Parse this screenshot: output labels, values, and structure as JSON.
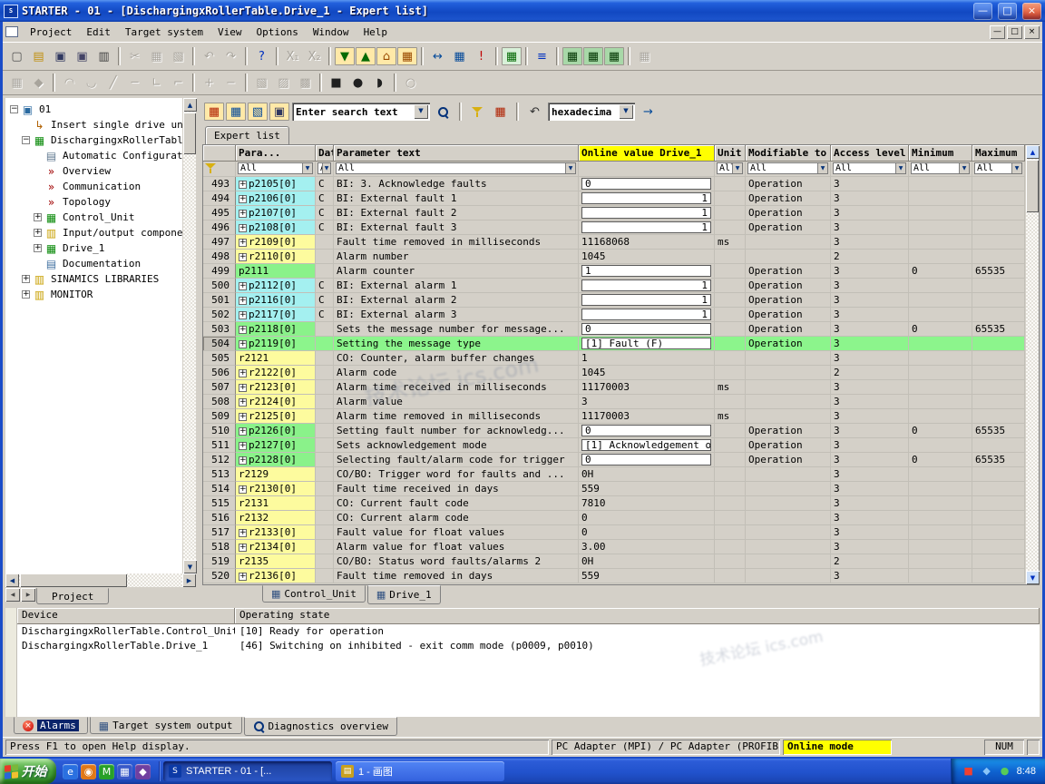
{
  "window": {
    "logo": "S",
    "title": "STARTER - 01 - [DischargingxRollerTable.Drive_1 - Expert list]",
    "controls": [
      "—",
      "□",
      "×"
    ],
    "menu": [
      "Project",
      "Edit",
      "Target system",
      "View",
      "Options",
      "Window",
      "Help"
    ]
  },
  "ui": {
    "up": "▲",
    "down": "▼",
    "left": "◀",
    "right": "▶",
    "combo": "▼"
  },
  "toolbars": {
    "row1": [
      {
        "name": "new-project",
        "glyph": "▢",
        "color": "#505050"
      },
      {
        "name": "open-project",
        "glyph": "▤",
        "color": "#c09010"
      },
      {
        "name": "save-project",
        "glyph": "▣",
        "color": "#303860"
      },
      {
        "name": "archive-project",
        "glyph": "▣",
        "color": "#446"
      },
      {
        "name": "print",
        "glyph": "▥",
        "color": "#404040"
      },
      {
        "sep": 1
      },
      {
        "name": "cut",
        "glyph": "✂",
        "dis": 1
      },
      {
        "name": "copy",
        "glyph": "▦",
        "dis": 1
      },
      {
        "name": "paste",
        "glyph": "▧",
        "dis": 1
      },
      {
        "sep": 1
      },
      {
        "name": "undo",
        "glyph": "↶",
        "dis": 1
      },
      {
        "name": "redo",
        "glyph": "↷",
        "dis": 1
      },
      {
        "sep": 1
      },
      {
        "name": "help",
        "glyph": "?",
        "color": "#0030c0"
      },
      {
        "sep": 1
      },
      {
        "name": "reference-x1",
        "glyph": "X₁",
        "dis": 1
      },
      {
        "name": "reference-x2",
        "glyph": "X₂",
        "dis": 1
      },
      {
        "sep": 1
      },
      {
        "name": "download-to-target",
        "glyph": "▼",
        "color": "#046a04",
        "bg": "#ffe9a8"
      },
      {
        "name": "upload-to-pg",
        "glyph": "▲",
        "color": "#046a04",
        "bg": "#ffe9a8"
      },
      {
        "name": "copy-ram-to-rom",
        "glyph": "⌂",
        "color": "#9a4a00",
        "bg": "#ffe9a8"
      },
      {
        "name": "load-to-file-system",
        "glyph": "▦",
        "color": "#9a4a00",
        "bg": "#ffe9a8"
      },
      {
        "sep": 1
      },
      {
        "name": "connect-drive",
        "glyph": "↔",
        "color": "#054a9a"
      },
      {
        "name": "compare-online-offline",
        "glyph": "▦",
        "color": "#054a9a"
      },
      {
        "name": "alarm-history",
        "glyph": "!",
        "color": "#c00000"
      },
      {
        "sep": 1
      },
      {
        "name": "accessible-nodes",
        "glyph": "▦",
        "color": "#056a05",
        "bg": "#d8f0d8"
      },
      {
        "sep": 1
      },
      {
        "name": "sort",
        "glyph": "≡",
        "color": "#0030c0"
      },
      {
        "sep": 1
      },
      {
        "name": "connect-to-target",
        "glyph": "▦",
        "color": "#053805",
        "bg": "#a8d8a8"
      },
      {
        "name": "disconnect-from-target",
        "glyph": "▦",
        "color": "#053805",
        "bg": "#a8d8a8"
      },
      {
        "name": "online-monitor",
        "glyph": "▦",
        "color": "#053805",
        "bg": "#a8d8a8"
      },
      {
        "sep": 1
      },
      {
        "name": "diagnostics",
        "glyph": "▦",
        "dis": 1
      }
    ],
    "row2": [
      {
        "name": "trace-grid",
        "glyph": "▦",
        "dis": 1
      },
      {
        "name": "function-generator",
        "glyph": "◆",
        "dis": 1
      },
      {
        "sep": 1
      },
      {
        "name": "curve-upper",
        "glyph": "◠",
        "dis": 1
      },
      {
        "name": "curve-lower",
        "glyph": "◡",
        "dis": 1
      },
      {
        "name": "line-diagonal",
        "glyph": "╱",
        "dis": 1
      },
      {
        "name": "line-horizontal",
        "glyph": "─",
        "dis": 1
      },
      {
        "name": "angle-tool",
        "glyph": "∟",
        "dis": 1
      },
      {
        "name": "step-tool",
        "glyph": "⌐",
        "dis": 1
      },
      {
        "sep": 1
      },
      {
        "name": "zoom-in",
        "glyph": "+",
        "dis": 1
      },
      {
        "name": "zoom-out",
        "glyph": "−",
        "dis": 1
      },
      {
        "sep": 1
      },
      {
        "name": "measure-grid-1",
        "glyph": "▧",
        "dis": 1
      },
      {
        "name": "measure-grid-2",
        "glyph": "▨",
        "dis": 1
      },
      {
        "name": "measure-grid-3",
        "glyph": "▩",
        "dis": 1
      },
      {
        "sep": 1
      },
      {
        "name": "shape-square",
        "glyph": "■",
        "color": "#202020"
      },
      {
        "name": "shape-circle",
        "glyph": "●",
        "color": "#202020"
      },
      {
        "name": "shape-half-circle",
        "glyph": "◗",
        "color": "#202020"
      },
      {
        "sep": 1
      },
      {
        "name": "marker",
        "glyph": "○",
        "dis": 1
      }
    ]
  },
  "tree": {
    "tab": "Project",
    "items": [
      {
        "label": "01",
        "level": 0,
        "expand": "minus",
        "icon": "project-node",
        "glyph": "▣",
        "color": "#2a6aa0"
      },
      {
        "label": "Insert single drive unit",
        "level": 1,
        "icon": "insert-drive-unit",
        "glyph": "↳",
        "color": "#b06000"
      },
      {
        "label": "DischargingxRollerTabl",
        "level": 1,
        "expand": "minus",
        "icon": "drive-unit",
        "glyph": "▦",
        "color": "#0a8a0a"
      },
      {
        "label": "Automatic Configuratio",
        "level": 2,
        "icon": "automatic-configuration",
        "glyph": "▤",
        "color": "#607890"
      },
      {
        "label": "Overview",
        "level": 2,
        "icon": "overview",
        "glyph": "»",
        "color": "#a00000"
      },
      {
        "label": "Communication",
        "level": 2,
        "icon": "communication",
        "glyph": "»",
        "color": "#a00000"
      },
      {
        "label": "Topology",
        "level": 2,
        "icon": "topology",
        "glyph": "»",
        "color": "#a00000"
      },
      {
        "label": "Control_Unit",
        "level": 2,
        "expand": "plus",
        "icon": "control-unit",
        "glyph": "▦",
        "color": "#0a8a0a"
      },
      {
        "label": "Input/output component",
        "level": 2,
        "expand": "plus",
        "icon": "io-components-folder",
        "glyph": "▥",
        "color": "#c8a000"
      },
      {
        "label": "Drive_1",
        "level": 2,
        "expand": "plus",
        "icon": "drive",
        "glyph": "▦",
        "color": "#0a8a0a"
      },
      {
        "label": "Documentation",
        "level": 2,
        "icon": "documentation",
        "glyph": "▤",
        "color": "#4070a0"
      },
      {
        "label": "SINAMICS LIBRARIES",
        "level": 1,
        "expand": "plus",
        "icon": "libraries-folder",
        "glyph": "▥",
        "color": "#c8a000"
      },
      {
        "label": "MONITOR",
        "level": 1,
        "expand": "plus",
        "icon": "monitor-folder",
        "glyph": "▥",
        "color": "#c8a000"
      }
    ]
  },
  "expert": {
    "tab": "Expert list",
    "search_text": "Enter search text",
    "number_format": "hexadecima",
    "toolbar": {
      "g1": [
        {
          "name": "expert-list-import",
          "glyph": "▦",
          "color": "#b02000",
          "bg": "#ffe9a8"
        },
        {
          "name": "expert-list-export",
          "glyph": "▦",
          "color": "#054a9a",
          "bg": "#ffe9a8"
        },
        {
          "name": "expert-list-open",
          "glyph": "▧",
          "color": "#054a9a",
          "bg": "#ffe9a8"
        },
        {
          "name": "expert-list-save",
          "glyph": "▣",
          "color": "#303860",
          "bg": "#ffe9a8"
        }
      ],
      "g2": [
        {
          "name": "find",
          "css": "find"
        }
      ],
      "g3": [
        {
          "name": "filter",
          "css": "funnel"
        },
        {
          "name": "edit-filter",
          "glyph": "▦",
          "color": "#b02000"
        }
      ],
      "g4": [
        {
          "name": "previous-view",
          "glyph": "↶",
          "color": "#303030"
        }
      ],
      "g5": [
        {
          "name": "apply-format",
          "glyph": "→",
          "color": "#054a9a"
        }
      ]
    },
    "columns": [
      "",
      "Para...",
      "Dat",
      "Parameter text",
      "Online value Drive_1",
      "Unit",
      "Modifiable to",
      "Access level",
      "Minimum",
      "Maximum"
    ],
    "filters": [
      "",
      "All",
      "All",
      "All",
      "",
      "All",
      "All",
      "All",
      "All",
      "All"
    ],
    "rows": [
      {
        "n": "493",
        "p": "p2105[0]",
        "pc": "c",
        "ex": 1,
        "d": "C",
        "t": "BI: 3. Acknowledge faults",
        "v": "0",
        "vb": 1,
        "va": "l",
        "m": "Operation",
        "a": "3"
      },
      {
        "n": "494",
        "p": "p2106[0]",
        "pc": "c",
        "ex": 1,
        "d": "C",
        "t": "BI: External fault 1",
        "v": "1",
        "vb": 1,
        "va": "r",
        "m": "Operation",
        "a": "3"
      },
      {
        "n": "495",
        "p": "p2107[0]",
        "pc": "c",
        "ex": 1,
        "d": "C",
        "t": "BI: External fault 2",
        "v": "1",
        "vb": 1,
        "va": "r",
        "m": "Operation",
        "a": "3"
      },
      {
        "n": "496",
        "p": "p2108[0]",
        "pc": "c",
        "ex": 1,
        "d": "C",
        "t": "BI: External fault 3",
        "v": "1",
        "vb": 1,
        "va": "r",
        "m": "Operation",
        "a": "3"
      },
      {
        "n": "497",
        "p": "r2109[0]",
        "pc": "y",
        "ex": 1,
        "t": "Fault time removed in milliseconds",
        "v": "11168068",
        "u": "ms",
        "a": "3"
      },
      {
        "n": "498",
        "p": "r2110[0]",
        "pc": "y",
        "ex": 1,
        "t": "Alarm number",
        "v": "1045",
        "a": "2"
      },
      {
        "n": "499",
        "p": "p2111",
        "pc": "g",
        "t": "Alarm counter",
        "v": "1",
        "vb": 1,
        "va": "l",
        "m": "Operation",
        "a": "3",
        "mn": "0",
        "mx": "65535"
      },
      {
        "n": "500",
        "p": "p2112[0]",
        "pc": "c",
        "ex": 1,
        "d": "C",
        "t": "BI: External alarm 1",
        "v": "1",
        "vb": 1,
        "va": "r",
        "m": "Operation",
        "a": "3"
      },
      {
        "n": "501",
        "p": "p2116[0]",
        "pc": "c",
        "ex": 1,
        "d": "C",
        "t": "BI: External alarm 2",
        "v": "1",
        "vb": 1,
        "va": "r",
        "m": "Operation",
        "a": "3"
      },
      {
        "n": "502",
        "p": "p2117[0]",
        "pc": "c",
        "ex": 1,
        "d": "C",
        "t": "BI: External alarm 3",
        "v": "1",
        "vb": 1,
        "va": "r",
        "m": "Operation",
        "a": "3"
      },
      {
        "n": "503",
        "p": "p2118[0]",
        "pc": "g",
        "ex": 1,
        "t": "Sets the message number for message...",
        "v": "0",
        "vb": 1,
        "va": "l",
        "m": "Operation",
        "a": "3",
        "mn": "0",
        "mx": "65535"
      },
      {
        "n": "504",
        "p": "p2119[0]",
        "pc": "g",
        "ex": 1,
        "t": "Setting the message type",
        "v": "[1] Fault (F)",
        "vb": 1,
        "va": "l",
        "m": "Operation",
        "a": "3",
        "sel": 1
      },
      {
        "n": "505",
        "p": "r2121",
        "pc": "y",
        "t": "CO: Counter, alarm buffer changes",
        "v": "1",
        "a": "3"
      },
      {
        "n": "506",
        "p": "r2122[0]",
        "pc": "y",
        "ex": 1,
        "t": "Alarm code",
        "v": "1045",
        "a": "2"
      },
      {
        "n": "507",
        "p": "r2123[0]",
        "pc": "y",
        "ex": 1,
        "t": "Alarm time received in milliseconds",
        "v": "11170003",
        "u": "ms",
        "a": "3"
      },
      {
        "n": "508",
        "p": "r2124[0]",
        "pc": "y",
        "ex": 1,
        "t": "Alarm value",
        "v": "3",
        "a": "3"
      },
      {
        "n": "509",
        "p": "r2125[0]",
        "pc": "y",
        "ex": 1,
        "t": "Alarm time removed in milliseconds",
        "v": "11170003",
        "u": "ms",
        "a": "3"
      },
      {
        "n": "510",
        "p": "p2126[0]",
        "pc": "g",
        "ex": 1,
        "t": "Setting fault number for acknowledg...",
        "v": "0",
        "vb": 1,
        "va": "l",
        "m": "Operation",
        "a": "3",
        "mn": "0",
        "mx": "65535"
      },
      {
        "n": "511",
        "p": "p2127[0]",
        "pc": "g",
        "ex": 1,
        "t": "Sets acknowledgement mode",
        "v": "[1] Acknowledgement o...",
        "vb": 1,
        "va": "l",
        "m": "Operation",
        "a": "3"
      },
      {
        "n": "512",
        "p": "p2128[0]",
        "pc": "g",
        "ex": 1,
        "t": "Selecting fault/alarm code for trigger",
        "v": "0",
        "vb": 1,
        "va": "l",
        "m": "Operation",
        "a": "3",
        "mn": "0",
        "mx": "65535"
      },
      {
        "n": "513",
        "p": "r2129",
        "pc": "y",
        "t": "CO/BO: Trigger word for faults and ...",
        "v": "0H",
        "a": "3"
      },
      {
        "n": "514",
        "p": "r2130[0]",
        "pc": "y",
        "ex": 1,
        "t": "Fault time received in days",
        "v": "559",
        "a": "3"
      },
      {
        "n": "515",
        "p": "r2131",
        "pc": "y",
        "t": "CO: Current fault code",
        "v": "7810",
        "a": "3"
      },
      {
        "n": "516",
        "p": "r2132",
        "pc": "y",
        "t": "CO: Current alarm code",
        "v": "0",
        "a": "3"
      },
      {
        "n": "517",
        "p": "r2133[0]",
        "pc": "y",
        "ex": 1,
        "t": "Fault value for float values",
        "v": "0",
        "a": "3"
      },
      {
        "n": "518",
        "p": "r2134[0]",
        "pc": "y",
        "ex": 1,
        "t": "Alarm value for float values",
        "v": "3.00",
        "a": "3"
      },
      {
        "n": "519",
        "p": "r2135",
        "pc": "y",
        "t": "CO/BO: Status word faults/alarms 2",
        "v": "0H",
        "a": "2"
      },
      {
        "n": "520",
        "p": "r2136[0]",
        "pc": "y",
        "ex": 1,
        "t": "Fault time removed in days",
        "v": "559",
        "a": "3"
      }
    ],
    "bottom_tabs": [
      {
        "label": "Control_Unit",
        "active": false
      },
      {
        "label": "Drive_1",
        "active": true
      }
    ]
  },
  "output": {
    "columns": [
      "Device",
      "Operating state"
    ],
    "rows": [
      {
        "device": "DischargingxRollerTable.Control_Unit",
        "state": "[10] Ready for operation"
      },
      {
        "device": "DischargingxRollerTable.Drive_1",
        "state": "[46] Switching on inhibited - exit comm mode (p0009, p0010)"
      }
    ],
    "tabs": [
      {
        "label": "Alarms",
        "icon": "alarm",
        "glyph": "×",
        "focus": true
      },
      {
        "label": "Target system output",
        "icon": "output-grid",
        "glyph": "▦"
      },
      {
        "label": "Diagnostics overview",
        "icon": "diagnostics",
        "active": true
      }
    ]
  },
  "status": {
    "help": "Press F1 to open Help display.",
    "adapter": "PC Adapter (MPI) / PC Adapter (PROFIB",
    "mode": "Online mode",
    "num": "NUM"
  },
  "taskbar": {
    "start": "开始",
    "quick_launch": [
      {
        "name": "internet-explorer",
        "glyph": "e",
        "bg": "#2a70e0"
      },
      {
        "name": "media-player",
        "glyph": "◉",
        "bg": "#e07818"
      },
      {
        "name": "messenger",
        "glyph": "M",
        "bg": "#28a028"
      },
      {
        "name": "show-desktop",
        "glyph": "▦",
        "bg": "#3858c8"
      },
      {
        "name": "launcher",
        "glyph": "◆",
        "bg": "#7040a0"
      }
    ],
    "tasks": [
      {
        "label": "STARTER - 01 - [...",
        "pressed": true,
        "icon_bg": "#0c3aa6",
        "icon_glyph": "S"
      },
      {
        "label": "1 - 画图",
        "pressed": false,
        "icon_bg": "#c8a020",
        "icon_glyph": "▤"
      }
    ],
    "tray_icons": [
      {
        "name": "tray-red",
        "glyph": "■",
        "color": "#f04030"
      },
      {
        "name": "tray-blue",
        "glyph": "◆",
        "color": "#8ac4f8"
      },
      {
        "name": "tray-green",
        "glyph": "●",
        "color": "#58cc58"
      }
    ],
    "time": "8:48"
  },
  "watermark": "技术论坛 ics.com"
}
